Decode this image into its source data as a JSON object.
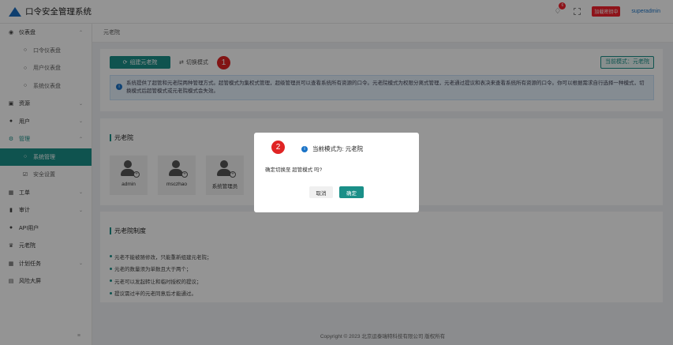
{
  "app": {
    "title": "口令安全管理系统"
  },
  "header": {
    "notification_count": "6",
    "env_tag": "加载密钥中",
    "username": "superadmin"
  },
  "sidebar": {
    "items": [
      {
        "label": "仪表盘",
        "icon": "dashboard-icon",
        "kind": "group"
      },
      {
        "label": "口令仪表盘",
        "icon": "circle-icon",
        "kind": "sub"
      },
      {
        "label": "用户仪表盘",
        "icon": "circle-icon",
        "kind": "sub"
      },
      {
        "label": "系统仪表盘",
        "icon": "circle-icon",
        "kind": "sub"
      },
      {
        "label": "资源",
        "icon": "lock-icon",
        "kind": "group"
      },
      {
        "label": "用户",
        "icon": "user-icon",
        "kind": "group"
      },
      {
        "label": "管理",
        "icon": "gear-icon",
        "kind": "group"
      },
      {
        "label": "系统管理",
        "icon": "circle-icon",
        "kind": "sub"
      },
      {
        "label": "安全设置",
        "icon": "shield-icon",
        "kind": "sub"
      },
      {
        "label": "工单",
        "icon": "ticket-icon",
        "kind": "group"
      },
      {
        "label": "审计",
        "icon": "audit-icon",
        "kind": "group"
      },
      {
        "label": "API用户",
        "icon": "api-user-icon",
        "kind": "single"
      },
      {
        "label": "元老院",
        "icon": "senate-icon",
        "kind": "single"
      },
      {
        "label": "计划任务",
        "icon": "calendar-icon",
        "kind": "group"
      },
      {
        "label": "风险大屏",
        "icon": "monitor-icon",
        "kind": "single"
      }
    ]
  },
  "breadcrumb": {
    "current": "元老院"
  },
  "toolbar": {
    "create_label": "组建元老院",
    "switch_label": "切换模式",
    "current_mode_label": "当前模式：元老院",
    "step1": "1"
  },
  "notice": {
    "text": "系统提供了超管和元老院两种管理方式。超管模式为集权式管理，超级管理员可以查看系统所有资源的口令。元老院模式为权限分离式管理，元老通过提议和表决来查看系统所有资源的口令。你可以根据需求自行选择一种模式，切换模式后超管模式或元老院模式会失效。"
  },
  "senate": {
    "title": "元老院",
    "members": [
      "admin",
      "msczhao",
      "系统管理员"
    ]
  },
  "rules": {
    "title": "元老院制度",
    "items": [
      "元老不能被随修改，只能重新组建元老院；",
      "元老的数量须为单数且大于两个；",
      "元老可以发起转让和临时授权的提议；",
      "提议需过半的元老同意后才能通过。"
    ]
  },
  "footer": {
    "text": "Copyright © 2023 北京运泰瑞特科技有限公司 版权所有"
  },
  "dialog": {
    "step2": "2",
    "title": "当前模式为: 元老院",
    "body": "确定切换至 超管模式 吗?",
    "cancel_label": "取消",
    "ok_label": "确定"
  },
  "colors": {
    "accent": "#1a8f88",
    "info": "#1a73c7",
    "danger": "#e02424"
  }
}
